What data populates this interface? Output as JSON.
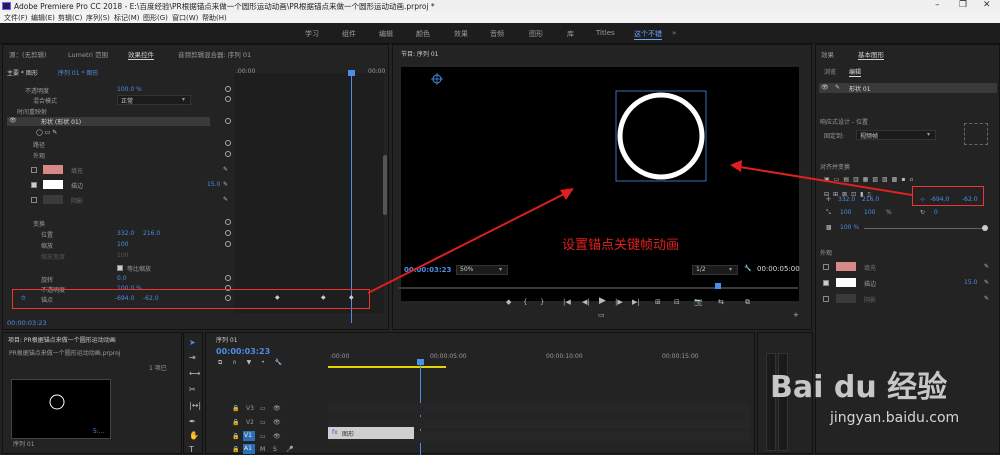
{
  "titlebar": {
    "title": "Adobe Premiere Pro CC 2018 - E:\\百度经验\\PR根据锚点来做一个圆形运动动画\\PR根据锚点来做一个圆形运动动画.prproj *"
  },
  "menu": [
    "文件(F)",
    "编辑(E)",
    "剪辑(C)",
    "序列(S)",
    "标记(M)",
    "图形(G)",
    "窗口(W)",
    "帮助(H)"
  ],
  "workspaces": [
    "学习",
    "组件",
    "编辑",
    "颜色",
    "效果",
    "音频",
    "图形",
    "库",
    "Titles",
    "这个不错"
  ],
  "active_workspace": "这个不错",
  "left_tabs": [
    "源：(无剪辑)",
    "Lumetri 范围",
    "效果控件",
    "音频剪辑混合器: 序列 01"
  ],
  "ec": {
    "header_left": "主要 * 图形",
    "header_right": "序列 01 * 图形",
    "time_start": ":00:00",
    "time_end": "00:00",
    "opacity_label": "不透明度",
    "opacity_value": "100.0 %",
    "blend_label": "混合模式",
    "blend_value": "正常",
    "remap_label": "时间重映射",
    "shape_label": "形状 (形状 01)",
    "path_label": "路径",
    "appearance_label": "外观",
    "fill_label": "填充",
    "stroke_label": "描边",
    "stroke_value": "15.0",
    "shadow_label": "阴影",
    "transform_label": "变换",
    "position_label": "位置",
    "position_x": "332.0",
    "position_y": "216.0",
    "scale_label": "缩放",
    "scale_value": "100",
    "scale_w_label": "缩放宽度",
    "scale_w_value": "100",
    "uniform_label": "等比缩放",
    "rotation_label": "旋转",
    "rotation_value": "0.0",
    "opacity2_label": "不透明度",
    "opacity2_value": "100.0 %",
    "anchor_label": "锚点",
    "anchor_x": "-694.0",
    "anchor_y": "-62.0",
    "timecode": "00:00:03:23"
  },
  "program": {
    "title": "节目: 序列 01",
    "timecode": "00:00:03:23",
    "zoom": "50%",
    "quality": "1/2",
    "duration": "00:00:05:00",
    "annotation": "设置锚点关键帧动画",
    "annotation_color": "#e02020"
  },
  "right": {
    "tabs": [
      "效果",
      "基本图形"
    ],
    "sub_tabs": [
      "浏览",
      "编辑"
    ],
    "layer": "形状 01",
    "responsive_label": "响应式设计 - 位置",
    "pin_label": "固定到:",
    "pin_value": "视频帧",
    "align_label": "对齐并变换",
    "pos_x": "332.0",
    "pos_y": "216.0",
    "anchor_x": "-694.0",
    "anchor_y": "-62.0",
    "scale": "100",
    "scale2": "100",
    "scale_unit": "%",
    "rot": "0",
    "opacity": "100 %",
    "appearance_label": "外观",
    "fill_label": "填充",
    "stroke_label": "描边",
    "stroke_value": "15.0",
    "shadow_label": "阴影"
  },
  "project": {
    "title": "项目: PR根据锚点来做一个圆形运动动画",
    "file": "PR根据锚点来做一个圆形运动动画.prproj",
    "items_label": "1 项已",
    "thumb_name": "序列 01",
    "thumb_dur": "5:..."
  },
  "timeline": {
    "title": "序列 01",
    "timecode": "00:00:03:23",
    "ruler": [
      ":00:00",
      "00:00:05:00",
      "00:00:10:00",
      "00:00:15:00"
    ],
    "tracks": [
      "V3",
      "V2",
      "V1",
      "A1"
    ],
    "clip_label": "图形"
  },
  "watermark": {
    "brand": "Bai du 经验",
    "url": "jingyan.baidu.com"
  },
  "colors": {
    "accent": "#4d8de6",
    "fill_swatch": "#d98888",
    "stroke_swatch": "#ffffff",
    "shadow_swatch": "#3a3a3a"
  }
}
